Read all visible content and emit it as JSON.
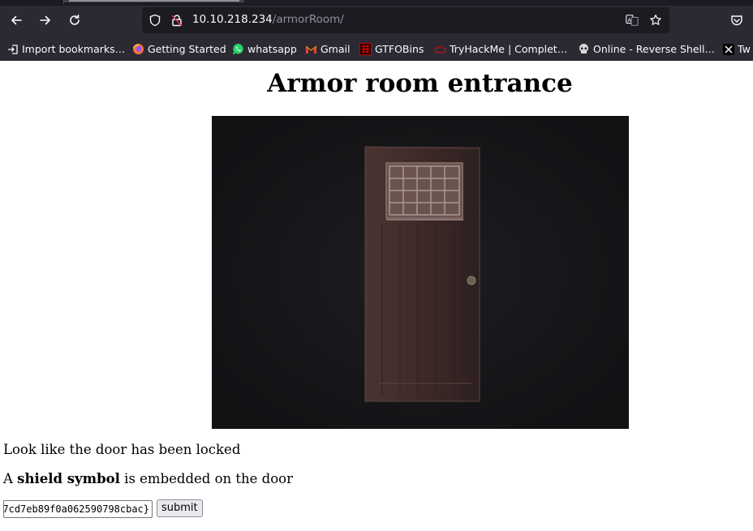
{
  "browser": {
    "url_host": "10.10.218.234",
    "url_path": "/armorRoom/",
    "bookmarks": [
      {
        "label": "Import bookmarks…",
        "icon": "import-icon"
      },
      {
        "label": "Getting Started",
        "icon": "firefox-icon"
      },
      {
        "label": "whatsapp",
        "icon": "whatsapp-icon"
      },
      {
        "label": "Gmail",
        "icon": "gmail-icon"
      },
      {
        "label": "GTFOBins",
        "icon": "gtfobins-icon"
      },
      {
        "label": "TryHackMe | Complet…",
        "icon": "tryhackme-icon"
      },
      {
        "label": "Online - Reverse Shell…",
        "icon": "skull-icon"
      },
      {
        "label": "Tw",
        "icon": "x-icon"
      }
    ]
  },
  "page": {
    "title": "Armor room entrance",
    "locked_text": "Look like the door has been locked",
    "shield_prefix": "A ",
    "shield_bold": "shield symbol",
    "shield_suffix": " is embedded on the door",
    "input_value": "7cd7eb89f0a062590798cbac}",
    "submit_label": "submit"
  }
}
